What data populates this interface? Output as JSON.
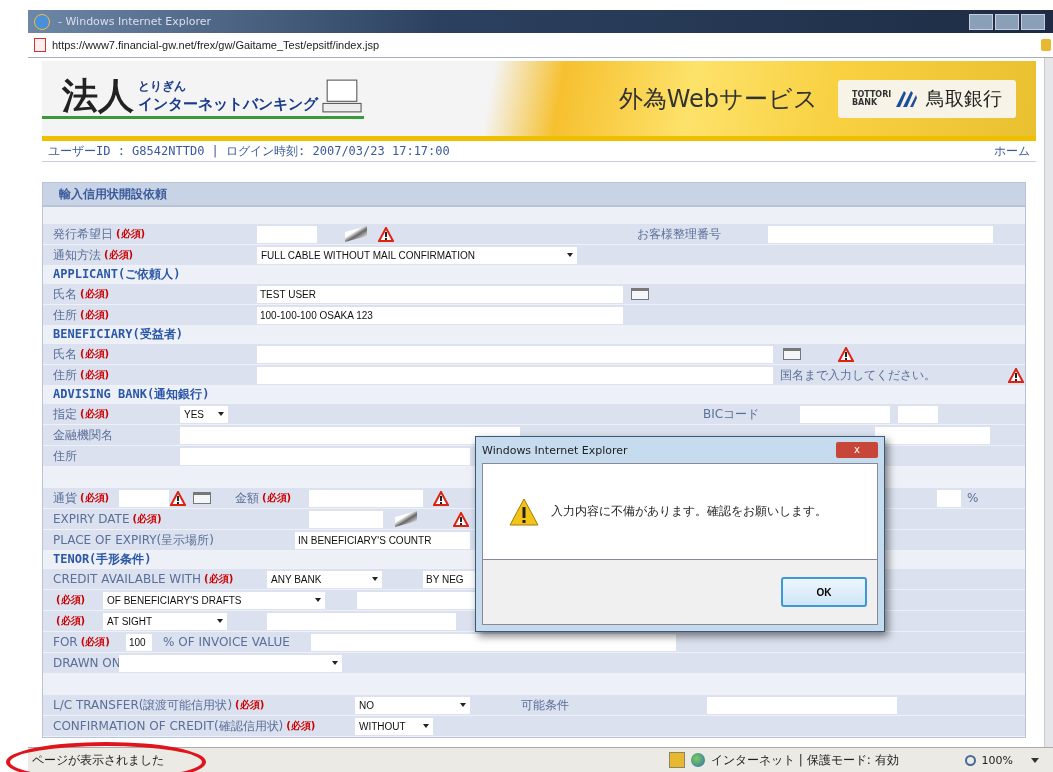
{
  "window": {
    "title": "- Windows Internet Explorer"
  },
  "address_bar": {
    "url": "https://www7.financial-gw.net/frex/gw/Gaitame_Test/epsitf/index.jsp"
  },
  "banner": {
    "brand_main": "法人",
    "brand_small": "とりぎん",
    "brand_sub": "インターネットバンキング",
    "service": "外為Webサービス",
    "bank_en": "TOTTORI BANK",
    "bank_name": "鳥取銀行"
  },
  "user_bar": {
    "info": "ユーザーID : G8542NTTD0 | ログイン時刻: 2007/03/23 17:17:00",
    "home_link": "ホーム"
  },
  "form": {
    "title": "輸入信用状開設依頼",
    "rows": [
      {
        "kind": "row",
        "items": [
          {
            "kind": "label",
            "text": "発行希望日",
            "required": "(必須)"
          },
          {
            "kind": "field",
            "value": ""
          },
          {
            "kind": "calendar"
          },
          {
            "kind": "warning"
          },
          {
            "kind": "label",
            "text": "お客様整理番号"
          },
          {
            "kind": "field",
            "value": ""
          }
        ]
      },
      {
        "kind": "row",
        "items": [
          {
            "kind": "label",
            "text": "通知方法",
            "required": "(必須)"
          },
          {
            "kind": "select",
            "value": "FULL CABLE WITHOUT MAIL CONFIRMATION"
          }
        ]
      },
      {
        "kind": "section",
        "text": "APPLICANT(ご依頼人)"
      },
      {
        "kind": "row",
        "items": [
          {
            "kind": "label",
            "text": "氏名",
            "required": "(必須)"
          },
          {
            "kind": "field",
            "value": "TEST USER"
          },
          {
            "kind": "window"
          }
        ]
      },
      {
        "kind": "row",
        "items": [
          {
            "kind": "label",
            "text": "住所",
            "required": "(必須)"
          },
          {
            "kind": "field",
            "value": "100-100-100 OSAKA 123"
          }
        ]
      },
      {
        "kind": "section",
        "text": "BENEFICIARY(受益者)"
      },
      {
        "kind": "row",
        "items": [
          {
            "kind": "label",
            "text": "氏名",
            "required": "(必須)"
          },
          {
            "kind": "field",
            "value": ""
          },
          {
            "kind": "window"
          },
          {
            "kind": "warning"
          }
        ]
      },
      {
        "kind": "row",
        "items": [
          {
            "kind": "label",
            "text": "住所",
            "required": "(必須)"
          },
          {
            "kind": "field",
            "value": ""
          },
          {
            "kind": "note",
            "text": "国名まで入力してください。"
          },
          {
            "kind": "warning"
          }
        ]
      },
      {
        "kind": "section",
        "text": "ADVISING BANK(通知銀行)"
      },
      {
        "kind": "row",
        "items": [
          {
            "kind": "label",
            "text": "指定",
            "required": "(必須)"
          },
          {
            "kind": "select",
            "value": "YES"
          },
          {
            "kind": "label",
            "text": "BICコード"
          },
          {
            "kind": "field",
            "value": ""
          },
          {
            "kind": "field",
            "value": ""
          }
        ]
      },
      {
        "kind": "row",
        "items": [
          {
            "kind": "label",
            "text": "金融機関名"
          },
          {
            "kind": "field",
            "value": ""
          },
          {
            "kind": "field",
            "value": ""
          }
        ]
      },
      {
        "kind": "row",
        "items": [
          {
            "kind": "label",
            "text": "住所"
          },
          {
            "kind": "field",
            "value": ""
          }
        ]
      },
      {
        "kind": "blank"
      },
      {
        "kind": "row",
        "items": [
          {
            "kind": "label",
            "text": "通貨",
            "required": "(必須)"
          },
          {
            "kind": "field",
            "value": ""
          },
          {
            "kind": "warning"
          },
          {
            "kind": "window"
          },
          {
            "kind": "label",
            "text": "金額",
            "required": "(必須)"
          },
          {
            "kind": "field",
            "value": ""
          },
          {
            "kind": "warning"
          },
          {
            "kind": "field",
            "value": ""
          },
          {
            "kind": "note",
            "text": "%"
          }
        ]
      },
      {
        "kind": "row",
        "items": [
          {
            "kind": "label",
            "text": "EXPIRY DATE",
            "required": "(必須)"
          },
          {
            "kind": "field",
            "value": ""
          },
          {
            "kind": "calendar"
          },
          {
            "kind": "warning"
          }
        ]
      },
      {
        "kind": "row",
        "items": [
          {
            "kind": "label",
            "text": "PLACE OF EXPIRY(呈示場所)"
          },
          {
            "kind": "field",
            "value": "IN BENEFICIARY'S COUNTR"
          }
        ]
      },
      {
        "kind": "section",
        "text": "TENOR(手形条件)"
      },
      {
        "kind": "row",
        "items": [
          {
            "kind": "label",
            "text": "CREDIT AVAILABLE WITH",
            "required": "(必須)"
          },
          {
            "kind": "select",
            "value": "ANY BANK"
          },
          {
            "kind": "field",
            "value": "BY NEG"
          }
        ]
      },
      {
        "kind": "row",
        "items": [
          {
            "kind": "label",
            "required": "(必須)"
          },
          {
            "kind": "select",
            "value": "OF BENEFICIARY'S DRAFTS"
          },
          {
            "kind": "field",
            "value": ""
          }
        ]
      },
      {
        "kind": "row",
        "items": [
          {
            "kind": "label",
            "required": "(必須)"
          },
          {
            "kind": "select",
            "value": "AT SIGHT"
          },
          {
            "kind": "field",
            "value": ""
          }
        ]
      },
      {
        "kind": "row",
        "items": [
          {
            "kind": "label",
            "text": "FOR",
            "required": "(必須)"
          },
          {
            "kind": "field",
            "value": "100"
          },
          {
            "kind": "note",
            "text": "% OF INVOICE VALUE"
          },
          {
            "kind": "field",
            "value": ""
          }
        ]
      },
      {
        "kind": "row",
        "items": [
          {
            "kind": "label",
            "text": "DRAWN ON"
          },
          {
            "kind": "select",
            "value": ""
          }
        ]
      },
      {
        "kind": "blank"
      },
      {
        "kind": "row",
        "items": [
          {
            "kind": "label",
            "text": "L/C TRANSFER(譲渡可能信用状)",
            "required": "(必須)"
          },
          {
            "kind": "select",
            "value": "NO"
          },
          {
            "kind": "label",
            "text": "可能条件"
          },
          {
            "kind": "field",
            "value": ""
          }
        ]
      },
      {
        "kind": "row",
        "items": [
          {
            "kind": "label",
            "text": "CONFIRMATION OF CREDIT(確認信用状)",
            "required": "(必須)"
          },
          {
            "kind": "select",
            "value": "WITHOUT"
          }
        ]
      }
    ]
  },
  "dialog": {
    "title": "Windows Internet Explorer",
    "close": "x",
    "message": "入力内容に不備があります。確認をお願いします。",
    "ok": "OK"
  },
  "status_bar": {
    "text": "ページが表示されました",
    "zone": "インターネット | 保護モード: 有効",
    "zoom": "100%"
  }
}
